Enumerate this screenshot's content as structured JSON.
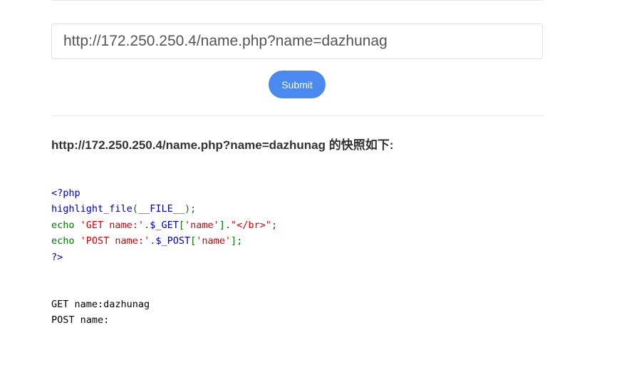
{
  "form": {
    "url_value": "http://172.250.250.4/name.php?name=dazhunag",
    "submit_label": "Submit"
  },
  "snapshot": {
    "heading": "http://172.250.250.4/name.php?name=dazhunag 的快照如下:"
  },
  "source_code": {
    "line1": "<?php",
    "line2_func": "highlight_file",
    "line2_open": "(",
    "line2_const": "__FILE__",
    "line2_close": ");",
    "line3_echo": "echo ",
    "line3_str": "'GET name:'",
    "line3_dot1": ".",
    "line3_var": "$_GET",
    "line3_br_open": "[",
    "line3_key": "'name'",
    "line3_br_close": "]",
    "line3_dot2": ".",
    "line3_str2": "\"</br>\"",
    "line3_end": ";",
    "line4_echo": "echo ",
    "line4_str": "'POST name:'",
    "line4_dot": ".",
    "line4_var": "$_POST",
    "line4_br_open": "[",
    "line4_key": "'name'",
    "line4_end": "];",
    "line5": "?>"
  },
  "output": {
    "get_line": "GET name:dazhunag",
    "post_line": "POST name:"
  }
}
